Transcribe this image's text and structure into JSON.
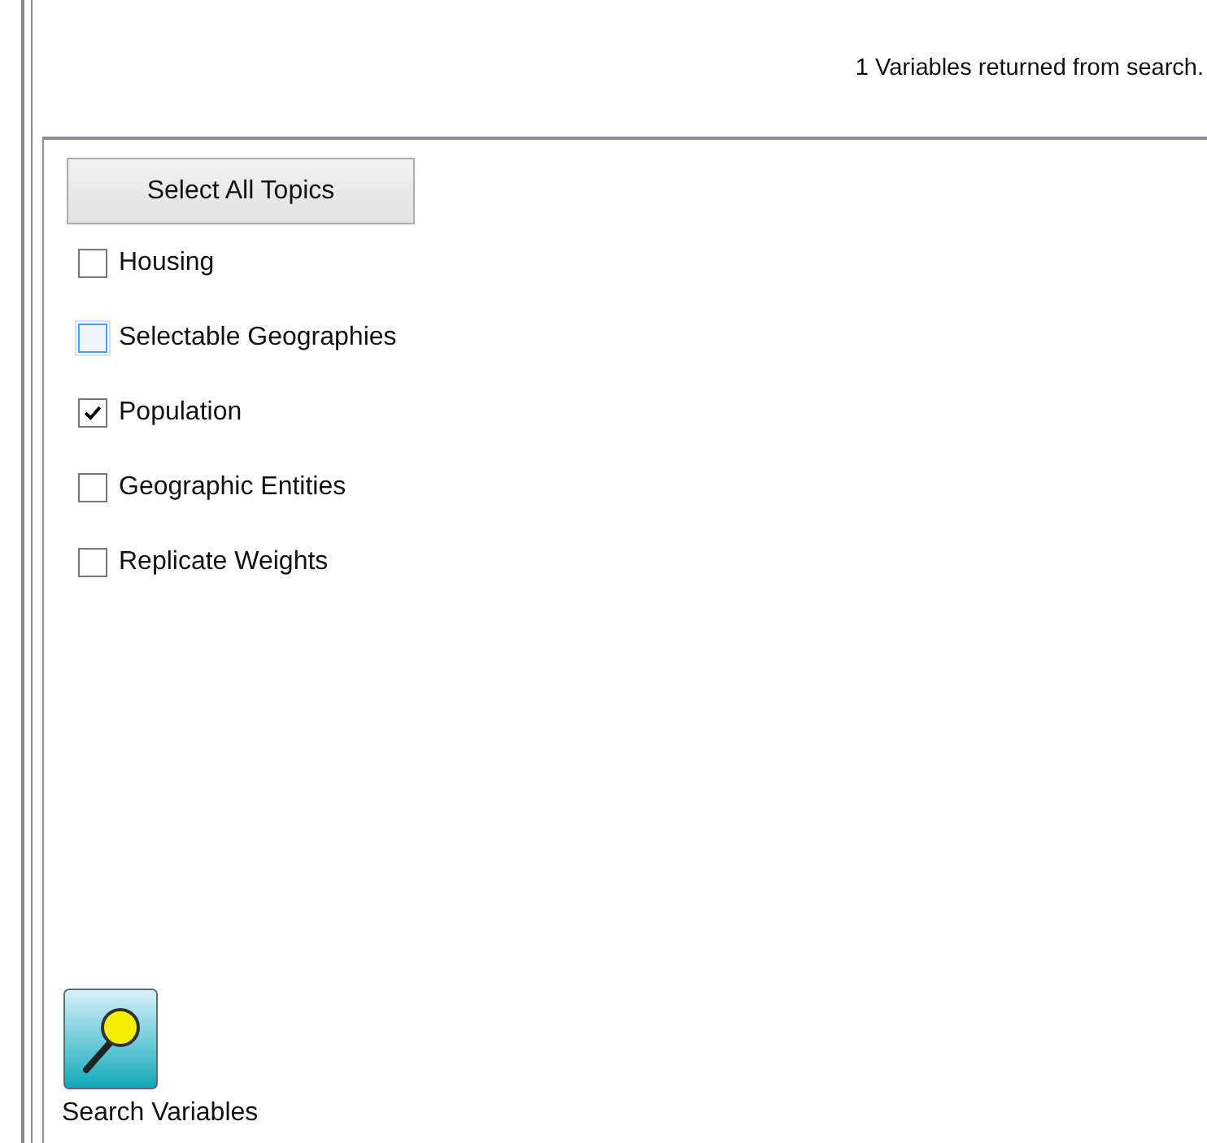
{
  "status": "1 Variables returned from search.",
  "select_all_button": "Select All Topics",
  "topics": [
    {
      "label": "Housing",
      "checked": false,
      "focused": false
    },
    {
      "label": "Selectable Geographies",
      "checked": false,
      "focused": true
    },
    {
      "label": "Population",
      "checked": true,
      "focused": false
    },
    {
      "label": "Geographic Entities",
      "checked": false,
      "focused": false
    },
    {
      "label": "Replicate Weights",
      "checked": false,
      "focused": false
    }
  ],
  "search_button": {
    "label": "Search Variables"
  }
}
